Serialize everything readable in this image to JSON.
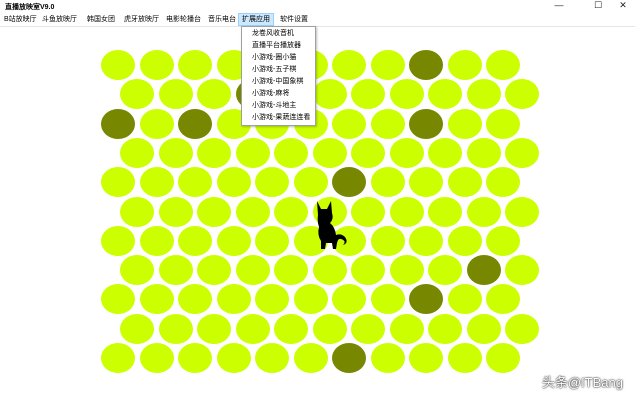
{
  "app": {
    "title": "直播放映室V9.0",
    "window_controls": [
      "—",
      "☐",
      "✕"
    ]
  },
  "menu": [
    {
      "label": "B站放映厅",
      "active": false
    },
    {
      "label": "斗鱼放映厅",
      "active": false
    },
    {
      "label": "韩国女团",
      "active": false
    },
    {
      "label": "虎牙放映厅",
      "active": false
    },
    {
      "label": "电影轮播台",
      "active": false
    },
    {
      "label": "音乐电台",
      "active": false
    },
    {
      "label": "扩展应用",
      "active": true
    },
    {
      "label": "软件设置",
      "active": false
    }
  ],
  "dropdown": {
    "items": [
      "龙卷风收音机",
      "直播平台播放器",
      "小游戏-圈小猫",
      "小游戏-五子棋",
      "小游戏-中国象棋",
      "小游戏-麻将",
      "小游戏-斗地主",
      "小游戏-果蔬连连看"
    ]
  },
  "game": {
    "rows": 11,
    "cols": 11,
    "empty_color": "#ccff00",
    "blocked_color": "#778800",
    "blocked_cells": [
      [
        0,
        8
      ],
      [
        1,
        3
      ],
      [
        2,
        0
      ],
      [
        2,
        2
      ],
      [
        2,
        8
      ],
      [
        4,
        6
      ],
      [
        7,
        9
      ],
      [
        8,
        8
      ],
      [
        10,
        6
      ]
    ],
    "cat_cell": [
      4,
      5
    ]
  },
  "watermark": "头条@ITBang"
}
